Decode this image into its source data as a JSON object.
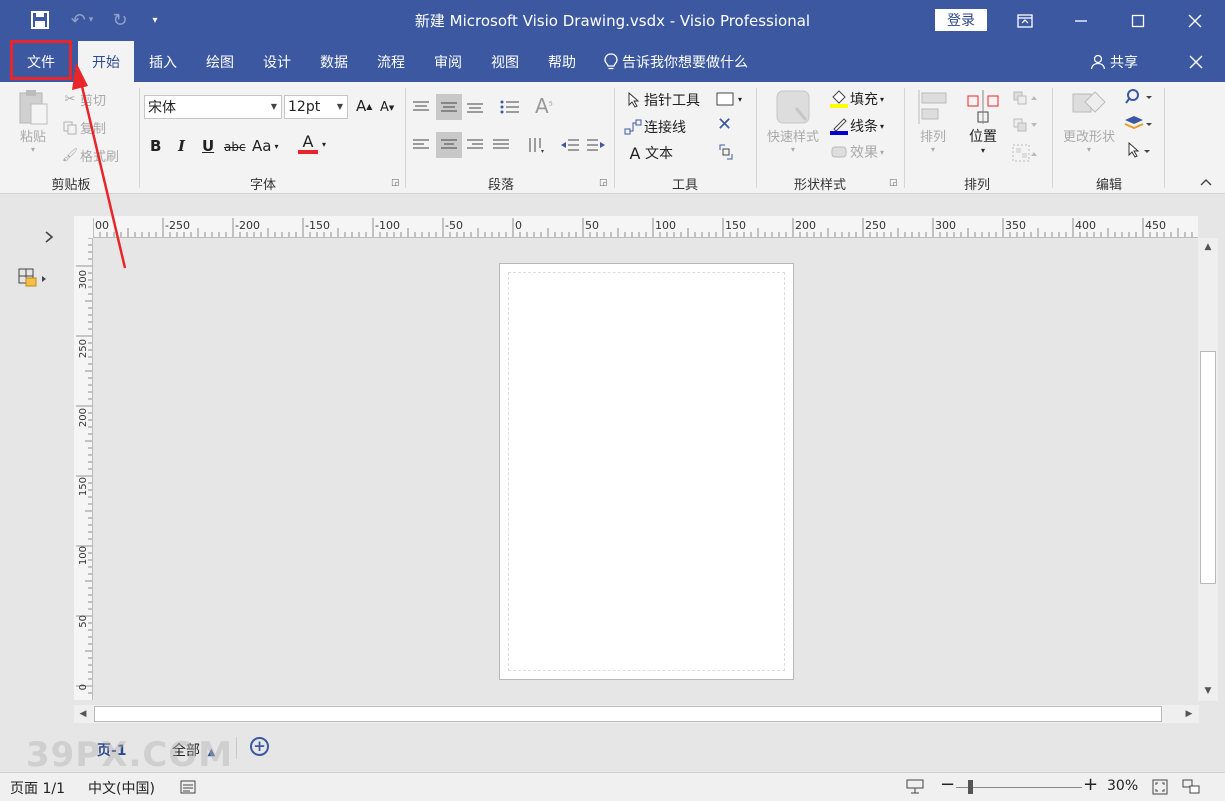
{
  "titlebar": {
    "doc_title": "新建 Microsoft Visio Drawing.vsdx  -  Visio Professional",
    "signin": "登录"
  },
  "tabs": {
    "file": "文件",
    "home": "开始",
    "insert": "插入",
    "draw": "绘图",
    "design": "设计",
    "data": "数据",
    "process": "流程",
    "review": "审阅",
    "view": "视图",
    "help": "帮助",
    "tell_me": "告诉我你想要做什么",
    "share": "共享"
  },
  "ribbon": {
    "clipboard": {
      "label": "剪贴板",
      "paste": "粘贴",
      "cut": "剪切",
      "copy": "复制",
      "format_painter": "格式刷"
    },
    "font": {
      "label": "字体",
      "font_name": "宋体",
      "font_size": "12pt",
      "grow": "A",
      "shrink": "A",
      "bold": "B",
      "italic": "I",
      "underline": "U",
      "strike": "abc",
      "case": "Aa",
      "color": "A"
    },
    "paragraph": {
      "label": "段落"
    },
    "tools": {
      "label": "工具",
      "pointer": "指针工具",
      "connector": "连接线",
      "text": "文本",
      "text_icon": "A"
    },
    "shape_styles": {
      "label": "形状样式",
      "quick_styles": "快速样式",
      "fill": "填充",
      "line": "线条",
      "effects": "效果"
    },
    "arrange": {
      "label": "排列",
      "align": "排列",
      "position": "位置"
    },
    "editing": {
      "label": "编辑",
      "change_shape": "更改形状"
    }
  },
  "ruler": {
    "horizontal": [
      "00",
      "-250",
      "-200",
      "-150",
      "-100",
      "-50",
      "0",
      "50",
      "100",
      "150",
      "200",
      "250",
      "300",
      "350",
      "400",
      "450"
    ],
    "vertical": [
      "300",
      "250",
      "200",
      "150",
      "100",
      "50",
      "0"
    ]
  },
  "page_tabs": {
    "page1": "页-1",
    "all": "全部",
    "add": "+"
  },
  "statusbar": {
    "page": "页面 1/1",
    "language": "中文(中国)",
    "zoom": "30%",
    "zoom_minus": "−",
    "zoom_plus": "+"
  },
  "watermark": "39PX.COM",
  "colors": {
    "brand": "#3b58a0",
    "highlight": "#e8262a"
  }
}
